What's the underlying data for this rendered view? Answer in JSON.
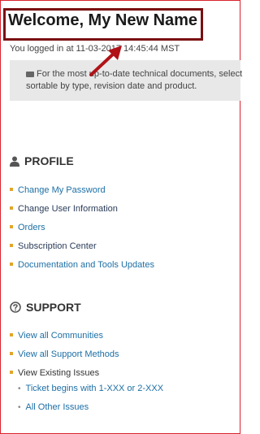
{
  "welcome": {
    "title": "Welcome, My New Name"
  },
  "login": {
    "text": "You logged in at 11-03-2017 14:45:44 MST"
  },
  "notice": {
    "text": "For the most up-to-date technical documents, select sortable by type, revision date and product."
  },
  "profile": {
    "heading": "PROFILE",
    "items": [
      {
        "label": "Change My Password"
      },
      {
        "label": "Change User Information"
      },
      {
        "label": "Orders"
      },
      {
        "label": "Subscription Center"
      },
      {
        "label": "Documentation and Tools Updates"
      }
    ]
  },
  "support": {
    "heading": "SUPPORT",
    "items": [
      {
        "label": "View all Communities"
      },
      {
        "label": "View all Support Methods"
      },
      {
        "label": "View Existing Issues"
      }
    ],
    "subitems": [
      {
        "label": "Ticket begins with 1-XXX or 2-XXX"
      },
      {
        "label": "All Other Issues"
      }
    ]
  },
  "colors": {
    "link": "#1d6fa5",
    "bullet": "#e1a52a",
    "frame": "#d9232d",
    "highlight": "#7a0f12",
    "arrow": "#b01218"
  }
}
